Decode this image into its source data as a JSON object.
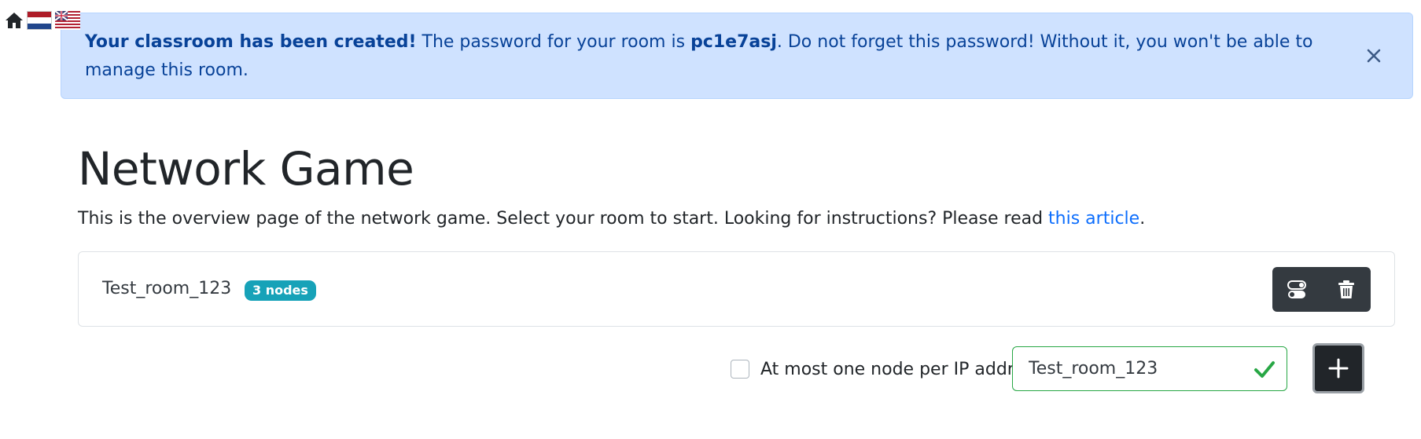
{
  "alert": {
    "bold_text": "Your classroom has been created!",
    "text_before_password": " The password for your room is ",
    "password": "pc1e7asj",
    "text_after_password": ". Do not forget this password! Without it, you won't be able to manage this room."
  },
  "page": {
    "title": "Network Game",
    "intro_text": "This is the overview page of the network game. Select your room to start. Looking for instructions? Please read ",
    "intro_link": "this article",
    "intro_end": "."
  },
  "rooms": [
    {
      "name": "Test_room_123",
      "badge": "3 nodes"
    }
  ],
  "add_room": {
    "checkbox_label": "At most one node per IP address",
    "checkbox_checked": false,
    "input_value": "Test_room_123",
    "input_valid": true
  },
  "icons": {
    "home": "home-icon",
    "flag_nl": "netherlands-flag-icon",
    "flag_en": "uk-us-flag-icon",
    "close": "close-icon",
    "toggle": "toggle-icon",
    "trash": "trash-icon",
    "check": "check-icon",
    "plus": "plus-icon"
  },
  "colors": {
    "alert_bg": "#cfe2ff",
    "alert_text": "#084298",
    "link": "#0d6efd",
    "badge": "#17a2b8",
    "dark_button": "#343a40",
    "valid": "#28a745"
  }
}
